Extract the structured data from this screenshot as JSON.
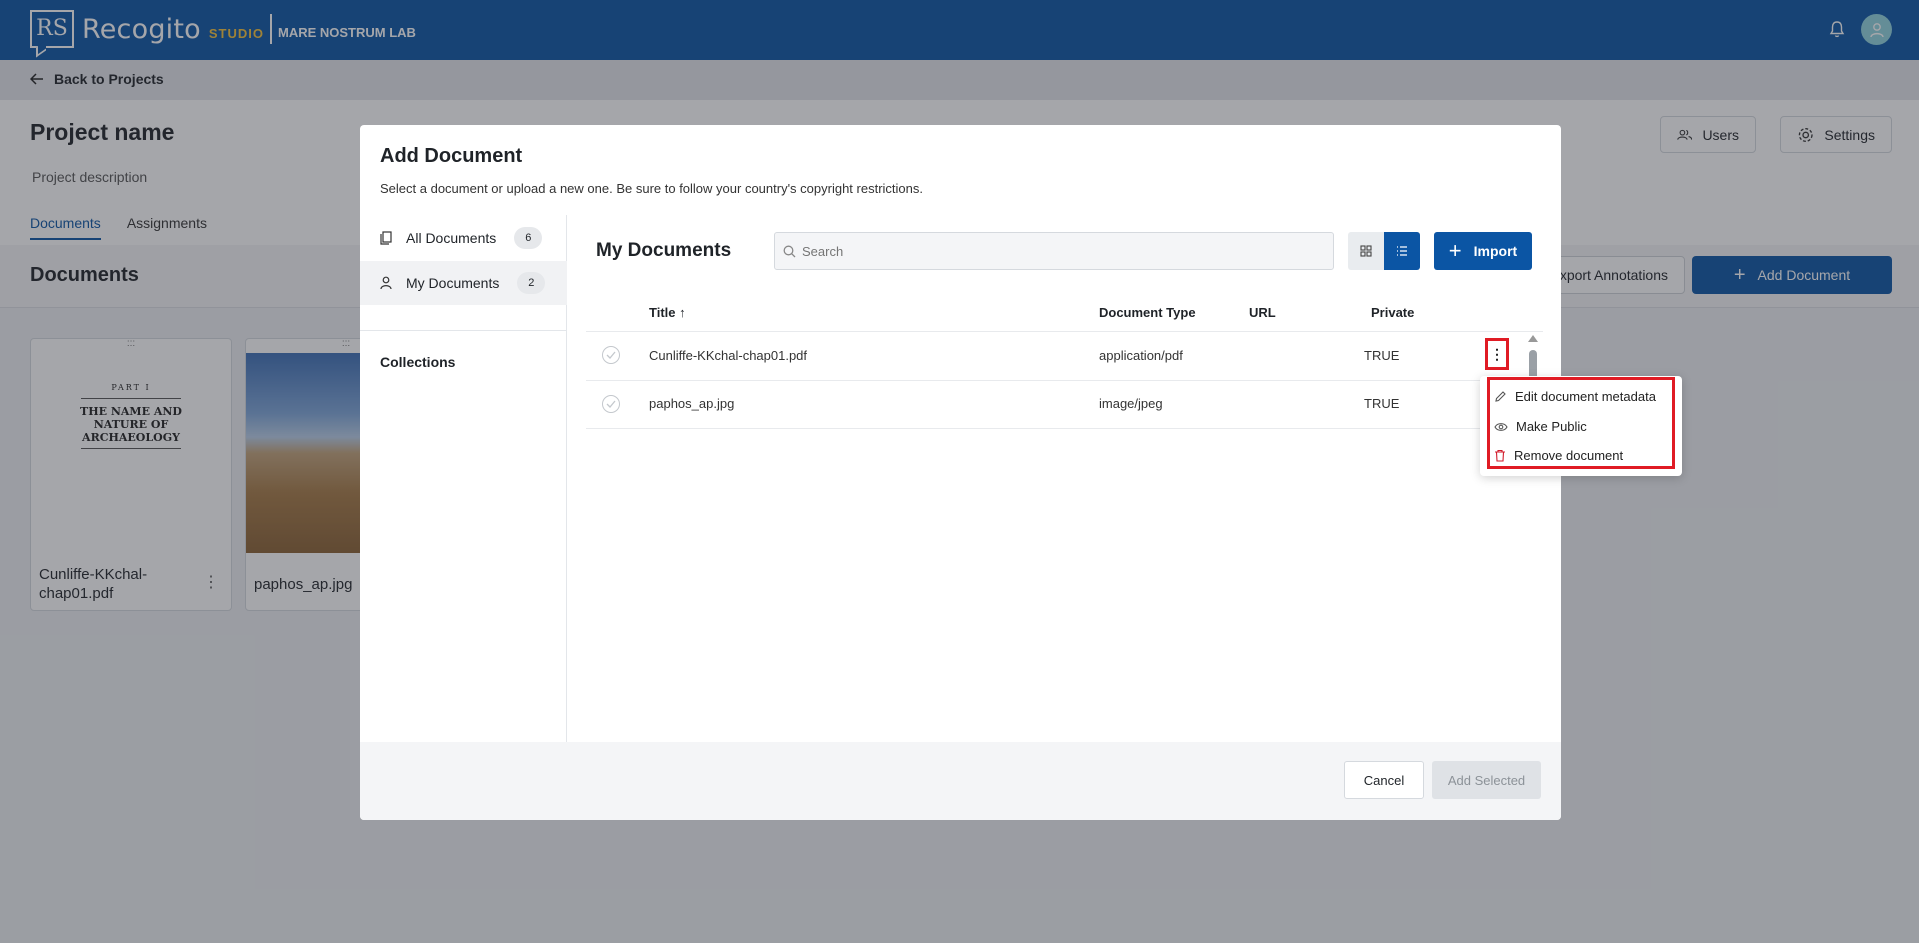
{
  "app": {
    "name": "Recogito",
    "studio": "STUDIO",
    "logo_letters": "RS",
    "org": "MARE NOSTRUM LAB",
    "brand_color": "#0b55a4"
  },
  "back": {
    "label": "Back to Projects"
  },
  "project": {
    "name": "Project name",
    "description": "Project description",
    "tabs": [
      "Documents",
      "Assignments"
    ],
    "users_label": "Users",
    "settings_label": "Settings"
  },
  "documents_section": {
    "title": "Documents",
    "export_label": "xport Annotations",
    "add_label": "Add Document",
    "cards": [
      {
        "label": "Cunliffe-KKchal-chap01.pdf",
        "cover_line1": "PART I",
        "cover_line2": "THE NAME AND",
        "cover_line3": "NATURE OF",
        "cover_line4": "ARCHAEOLOGY"
      },
      {
        "label": "paphos_ap.jpg"
      }
    ]
  },
  "modal": {
    "title": "Add Document",
    "subtitle": "Select a document or upload a new one. Be sure to follow your country's copyright restrictions.",
    "sidebar": {
      "items": [
        {
          "label": "All Documents",
          "count": "6",
          "icon": "documents-icon"
        },
        {
          "label": "My Documents",
          "count": "2",
          "icon": "user-icon"
        }
      ],
      "collections_label": "Collections"
    },
    "main_title": "My Documents",
    "search": {
      "placeholder": "Search",
      "value": ""
    },
    "import_label": "Import",
    "columns": [
      "Title",
      "Document Type",
      "URL",
      "Private"
    ],
    "sort_indicator": "↑",
    "rows": [
      {
        "title": "Cunliffe-KKchal-chap01.pdf",
        "type": "application/pdf",
        "url": "",
        "private": "TRUE"
      },
      {
        "title": "paphos_ap.jpg",
        "type": "image/jpeg",
        "url": "",
        "private": "TRUE"
      }
    ],
    "kebab": "⋮",
    "footer": {
      "cancel": "Cancel",
      "add_selected": "Add Selected"
    }
  },
  "context_menu": {
    "items": [
      {
        "label": "Edit document metadata",
        "icon": "pencil-icon"
      },
      {
        "label": "Make Public",
        "icon": "eye-icon"
      },
      {
        "label": "Remove document",
        "icon": "trash-icon",
        "color": "#d11a2a"
      }
    ]
  },
  "highlight_color": "#e01b24"
}
